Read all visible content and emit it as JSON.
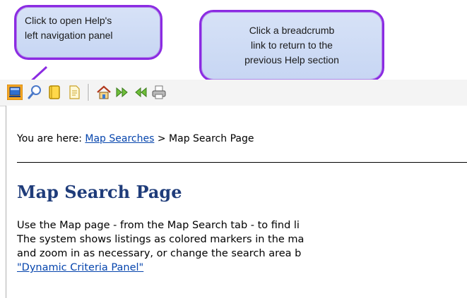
{
  "callouts": {
    "nav_panel": {
      "line1": "Click to open Help's",
      "line2": "left navigation panel"
    },
    "breadcrumb": {
      "line1": "Click a breadcrumb",
      "line2": "link to return to the",
      "line3": "previous Help section"
    }
  },
  "toolbar": {
    "icons": [
      "navigation-panel-icon",
      "search-icon",
      "index-icon",
      "page-icon",
      "home-icon",
      "next-icon",
      "previous-icon",
      "print-icon"
    ]
  },
  "breadcrumb": {
    "prefix": "You are here: ",
    "link": "Map Searches",
    "separator": " > ",
    "current": "Map Search Page"
  },
  "page": {
    "title": "Map Search Page",
    "line1": "Use the Map page - from the Map Search tab - to find li",
    "line2": "The system shows listings as colored markers in the ma",
    "line3": "and zoom in as necessary, or change the search area b",
    "link": "\"Dynamic Criteria Panel\""
  },
  "colors": {
    "callout_border": "#8b2be2",
    "callout_fill": "#d7e2f7",
    "title": "#1f3c7a",
    "link": "#0645ad"
  }
}
